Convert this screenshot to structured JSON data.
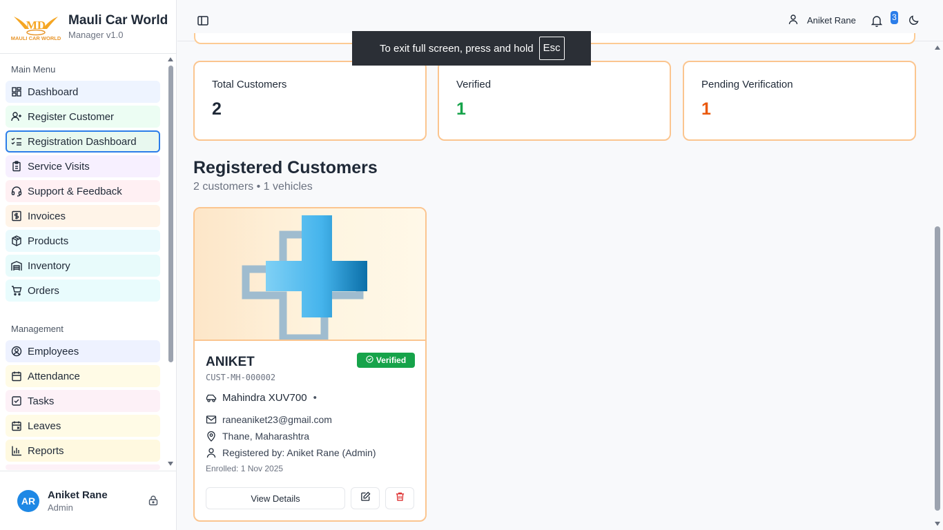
{
  "brand": {
    "name": "Mauli Car World",
    "version": "Manager v1.0",
    "logo_text": "MAULI CAR WORLD"
  },
  "sidebar": {
    "main_menu_label": "Main Menu",
    "main_items": [
      {
        "label": "Dashboard",
        "icon": "grid-icon",
        "color": "#eef4ff"
      },
      {
        "label": "Register Customer",
        "icon": "user-plus-icon",
        "color": "#ecfdf3"
      },
      {
        "label": "Registration Dashboard",
        "icon": "list-check-icon",
        "color": "#e8f8ef",
        "active": true
      },
      {
        "label": "Service Visits",
        "icon": "clipboard-icon",
        "color": "#f7f0ff"
      },
      {
        "label": "Support & Feedback",
        "icon": "headset-icon",
        "color": "#fff0f3"
      },
      {
        "label": "Invoices",
        "icon": "dollar-receipt-icon",
        "color": "#fff4e8"
      },
      {
        "label": "Products",
        "icon": "package-icon",
        "color": "#eafafd"
      },
      {
        "label": "Inventory",
        "icon": "warehouse-icon",
        "color": "#e8fbfb"
      },
      {
        "label": "Orders",
        "icon": "cart-icon",
        "color": "#e9fcfd"
      }
    ],
    "management_label": "Management",
    "management_items": [
      {
        "label": "Employees",
        "icon": "user-circle-icon",
        "color": "#eef2ff"
      },
      {
        "label": "Attendance",
        "icon": "calendar-icon",
        "color": "#fffbe6"
      },
      {
        "label": "Tasks",
        "icon": "checkbox-icon",
        "color": "#fdf1f7"
      },
      {
        "label": "Leaves",
        "icon": "calendar-x-icon",
        "color": "#fffbe6"
      },
      {
        "label": "Reports",
        "icon": "bar-chart-icon",
        "color": "#fff9e0"
      }
    ]
  },
  "footer_user": {
    "initials": "AR",
    "name": "Aniket Rane",
    "role": "Admin"
  },
  "topbar": {
    "user_name": "Aniket Rane",
    "notification_count": "3"
  },
  "toast": {
    "text": "To exit full screen, press and hold",
    "key": "Esc"
  },
  "stats": [
    {
      "label": "Total Customers",
      "value": "2",
      "color": "#1f2937"
    },
    {
      "label": "Verified",
      "value": "1",
      "color": "#16a34a"
    },
    {
      "label": "Pending Verification",
      "value": "1",
      "color": "#ea580c"
    }
  ],
  "section": {
    "title": "Registered Customers",
    "subtitle": "2 customers • 1 vehicles"
  },
  "customer": {
    "name": "ANIKET",
    "id": "CUST-MH-000002",
    "status": "Verified",
    "vehicle": "Mahindra XUV700",
    "email": "raneaniket23@gmail.com",
    "location": "Thane, Maharashtra",
    "registered_by": "Registered by: Aniket Rane (Admin)",
    "enrolled": "Enrolled: 1 Nov 2025",
    "view_label": "View Details"
  }
}
